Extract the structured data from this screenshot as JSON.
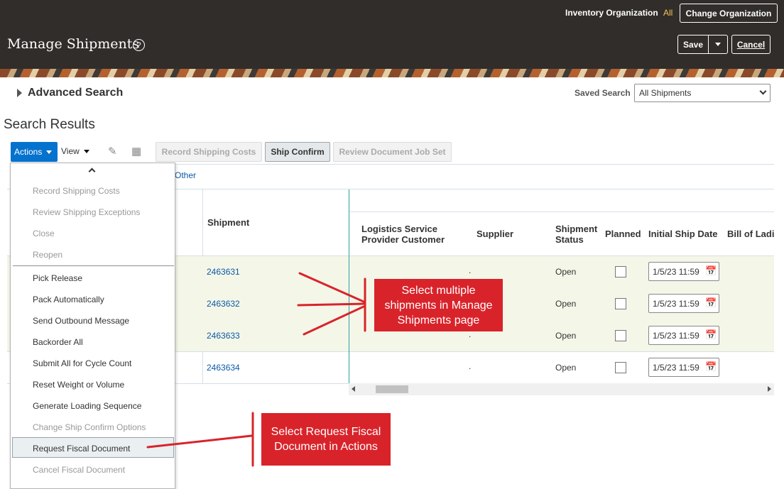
{
  "header": {
    "org_label": "Inventory Organization",
    "org_value": "All",
    "change_org": "Change Organization",
    "title": "Manage Shipments",
    "help_glyph": "?",
    "save": "Save",
    "cancel": "Cancel",
    "save_menu_icon": "triangle-down-icon"
  },
  "search": {
    "advanced_label": "Advanced Search",
    "saved_label": "Saved Search",
    "saved_value": "All Shipments"
  },
  "results": {
    "title": "Search Results",
    "actions_label": "Actions",
    "view_label": "View",
    "toolbar_buttons": [
      "Record Shipping Costs",
      "Ship Confirm",
      "Review Document Job Set"
    ],
    "other_link": "Other",
    "columns": {
      "shipment": "Shipment",
      "lsp_line1": "Logistics Service",
      "lsp_line2": "Provider Customer",
      "supplier": "Supplier",
      "status_line1": "Shipment",
      "status_line2": "Status",
      "planned": "Planned",
      "initial_ship_date": "Initial Ship Date",
      "bill_of_lading": "Bill of Ladi"
    },
    "rows": [
      {
        "shipment": "2463631",
        "supplier": ".",
        "status": "Open",
        "date": "1/5/23 11:59",
        "selected": true
      },
      {
        "shipment": "2463632",
        "supplier": ".",
        "status": "Open",
        "date": "1/5/23 11:59",
        "selected": true
      },
      {
        "shipment": "2463633",
        "supplier": ".",
        "status": "Open",
        "date": "1/5/23 11:59",
        "selected": true
      },
      {
        "shipment": "2463634",
        "supplier": ".",
        "status": "Open",
        "date": "1/5/23 11:59",
        "selected": false
      }
    ]
  },
  "actions_menu": {
    "items": [
      {
        "label": "Record Shipping Costs",
        "enabled": false
      },
      {
        "label": "Review Shipping Exceptions",
        "enabled": false
      },
      {
        "label": "Close",
        "enabled": false
      },
      {
        "label": "Reopen",
        "enabled": false
      },
      {
        "label": "Pick Release",
        "enabled": true
      },
      {
        "label": "Pack Automatically",
        "enabled": true
      },
      {
        "label": "Send Outbound Message",
        "enabled": true
      },
      {
        "label": "Backorder All",
        "enabled": true
      },
      {
        "label": "Submit All for Cycle Count",
        "enabled": true
      },
      {
        "label": "Reset Weight or Volume",
        "enabled": true
      },
      {
        "label": "Generate Loading Sequence",
        "enabled": true
      },
      {
        "label": "Change Ship Confirm Options",
        "enabled": false
      },
      {
        "label": "Request Fiscal Document",
        "enabled": true
      },
      {
        "label": "Cancel Fiscal Document",
        "enabled": false
      }
    ]
  },
  "annotations": {
    "callout1": [
      "Select multiple",
      "shipments in Manage",
      "Shipments page"
    ],
    "callout2": [
      "Select Request Fiscal",
      "Document in Actions"
    ],
    "color": "#d9232a"
  },
  "colors": {
    "header_bg": "#312d2a",
    "accent_blue": "#0572ce",
    "org_value": "#f5c35a",
    "selected_row": "#f4f6e8"
  }
}
